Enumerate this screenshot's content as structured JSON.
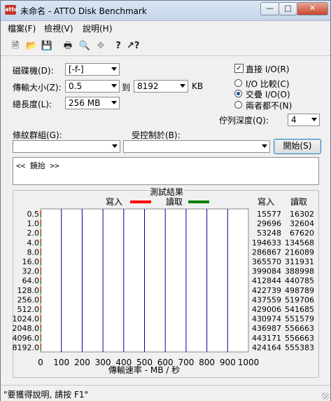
{
  "window": {
    "title": "未命名 - ATTO Disk Benchmark",
    "app_icon_text": "atto",
    "min_label": "—",
    "max_label": "□",
    "close_label": "✕"
  },
  "menu": {
    "items": [
      "檔案(F)",
      "檢視(V)",
      "說明(H)"
    ]
  },
  "toolbar": {
    "icons": [
      "new-file-icon",
      "open-folder-icon",
      "save-icon",
      "print-icon",
      "print-preview-icon",
      "move-icon",
      "help-icon",
      "context-help-icon"
    ]
  },
  "settings": {
    "drive_label": "磁碟機(D):",
    "drive_value": "[-f-]",
    "transfer_label": "傳輸大小(Z):",
    "transfer_from": "0.5",
    "to_label": "到",
    "transfer_to": "8192",
    "kb_label": "KB",
    "length_label": "總長度(L):",
    "length_value": "256 MB",
    "direct_io_label": "直接 I/O(R)",
    "direct_io_checked": true,
    "io_compare_label": "I/O 比較(C)",
    "overlap_io_label": "交疊 I/O(O)",
    "neither_label": "兩者都不(N)",
    "queue_label": "佇列深度(Q):",
    "queue_value": "4",
    "stripe_label": "條紋群組(G):",
    "stripe_value": "",
    "controlled_label": "受控制於(B):",
    "controlled_value": "",
    "start_label": "開始(S)"
  },
  "notes": {
    "text": "<< 鏡抬 >>"
  },
  "results": {
    "group_title": "測試結果",
    "legend_write": "寫入",
    "legend_read": "讀取",
    "col_write": "寫入",
    "col_read": "讀取",
    "xlabel": "傳輸速率 - MB / 秒",
    "write_color": "#ff0000",
    "read_color": "#008000",
    "grid_color": "#0000a0"
  },
  "chart_data": {
    "type": "bar",
    "orientation": "horizontal",
    "categories": [
      "0.5",
      "1.0",
      "2.0",
      "4.0",
      "8.0",
      "16.0",
      "32.0",
      "64.0",
      "128.0",
      "256.0",
      "512.0",
      "1024.0",
      "2048.0",
      "4096.0",
      "8192.0"
    ],
    "series": [
      {
        "name": "寫入",
        "values": [
          15577,
          29696,
          53248,
          194633,
          286867,
          365570,
          399084,
          412844,
          422739,
          437559,
          429006,
          430974,
          436987,
          443171,
          424164
        ]
      },
      {
        "name": "讀取",
        "values": [
          16302,
          32604,
          67620,
          134568,
          216089,
          311931,
          388998,
          440785,
          498789,
          519706,
          541685,
          551579,
          556663,
          556663,
          555383
        ]
      }
    ],
    "xlabel": "傳輸速率 - MB / 秒",
    "xticks": [
      "0",
      "100",
      "200",
      "300",
      "400",
      "500",
      "600",
      "700",
      "800",
      "900",
      "1000"
    ],
    "xlim": [
      0,
      1000
    ],
    "grid": true,
    "legend": "top"
  },
  "status": {
    "text": "\"要獲得說明, 請按 F1\""
  }
}
